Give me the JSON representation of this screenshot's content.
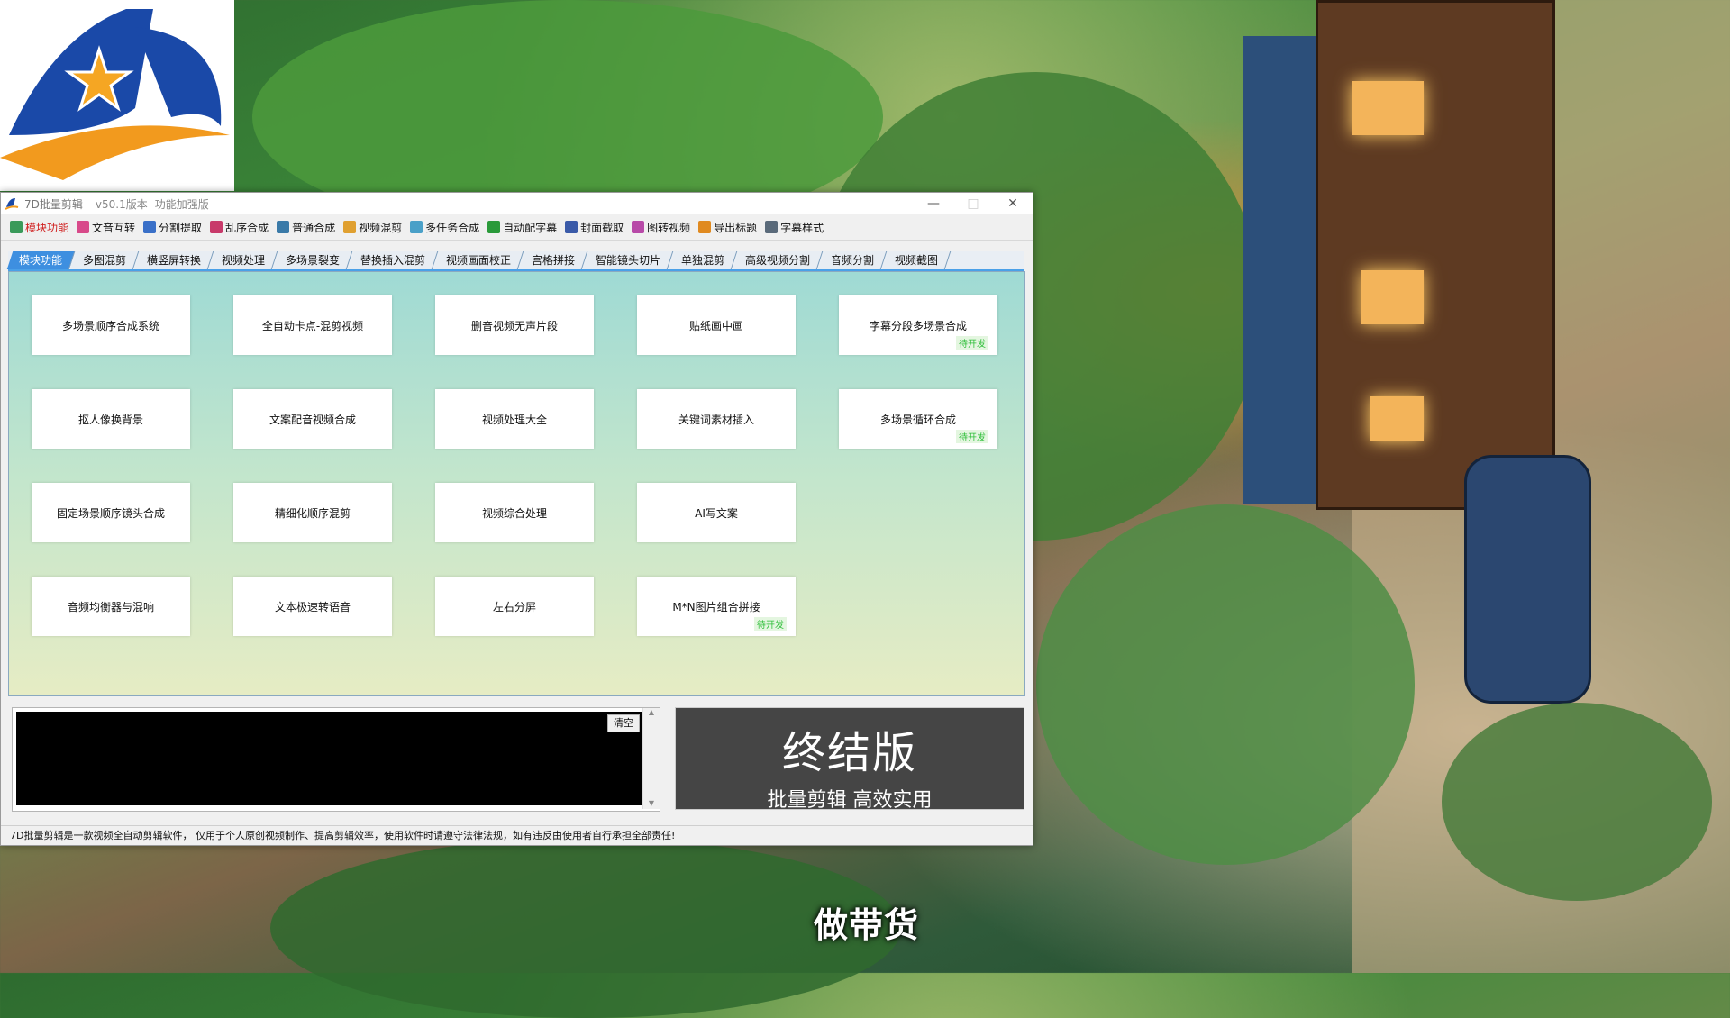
{
  "window": {
    "title": "7D批量剪辑",
    "version": "v50.1版本",
    "subtitle": "功能加强版",
    "minimize": "—",
    "maximize": "□",
    "close": "✕"
  },
  "toolbar": [
    {
      "label": "模块功能",
      "icon": "grid-icon",
      "color": "#3a9a5a",
      "active": true
    },
    {
      "label": "文音互转",
      "icon": "text-audio-icon",
      "color": "#d84a8a"
    },
    {
      "label": "分割提取",
      "icon": "split-icon",
      "color": "#3a70c8"
    },
    {
      "label": "乱序合成",
      "icon": "shuffle-icon",
      "color": "#c83a6a"
    },
    {
      "label": "普通合成",
      "icon": "layers-icon",
      "color": "#3a7aa8"
    },
    {
      "label": "视频混剪",
      "icon": "video-mix-icon",
      "color": "#e0a030"
    },
    {
      "label": "多任务合成",
      "icon": "multitask-icon",
      "color": "#4aa0c8"
    },
    {
      "label": "自动配字幕",
      "icon": "subtitle-icon",
      "color": "#2a9a3a"
    },
    {
      "label": "封面截取",
      "icon": "cover-icon",
      "color": "#3a5aa8"
    },
    {
      "label": "图转视频",
      "icon": "image-video-icon",
      "color": "#b84aa8"
    },
    {
      "label": "导出标题",
      "icon": "export-icon",
      "color": "#e08a20"
    },
    {
      "label": "字幕样式",
      "icon": "text-style-icon",
      "color": "#5a6a7a"
    }
  ],
  "tabs": [
    "模块功能",
    "多图混剪",
    "横竖屏转换",
    "视频处理",
    "多场景裂变",
    "替换插入混剪",
    "视频画面校正",
    "宫格拼接",
    "智能镜头切片",
    "单独混剪",
    "高级视频分割",
    "音频分割",
    "视频截图"
  ],
  "cards": [
    {
      "label": "多场景顺序合成系统"
    },
    {
      "label": "全自动卡点-混剪视频"
    },
    {
      "label": "删音视频无声片段"
    },
    {
      "label": "贴纸画中画"
    },
    {
      "label": "字幕分段多场景合成",
      "badge": "待开发"
    },
    {
      "label": "抠人像换背景"
    },
    {
      "label": "文案配音视频合成"
    },
    {
      "label": "视频处理大全"
    },
    {
      "label": "关键词素材插入"
    },
    {
      "label": "多场景循环合成",
      "badge": "待开发"
    },
    {
      "label": "固定场景顺序镜头合成"
    },
    {
      "label": "精细化顺序混剪"
    },
    {
      "label": "视频综合处理"
    },
    {
      "label": "AI写文案"
    },
    {
      "label": "音频均衡器与混响"
    },
    {
      "label": "文本极速转语音"
    },
    {
      "label": "左右分屏"
    },
    {
      "label": "M*N图片组合拼接",
      "badge": "待开发"
    }
  ],
  "log": {
    "clear_label": "清空"
  },
  "banner": {
    "title": "终结版",
    "subtitle": "批量剪辑 高效实用"
  },
  "status": "7D批量剪辑是一款视频全自动剪辑软件， 仅用于个人原创视频制作、提高剪辑效率，使用软件时请遵守法律法规，如有违反由使用者自行承担全部责任!",
  "video_subtitle": "做带货"
}
